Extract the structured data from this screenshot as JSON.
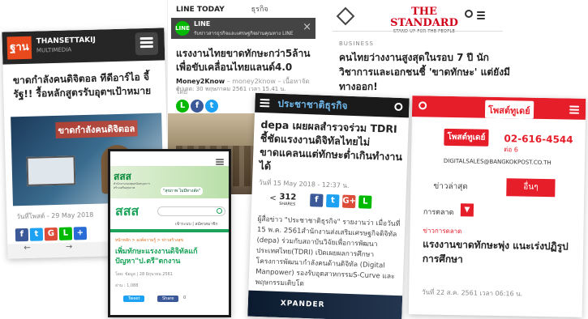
{
  "card1": {
    "logo_text": "ฐาน",
    "logo_sub": "THANSETTAKIJ",
    "logo_sub2": "MULTIMEDIA",
    "headline": "ขาดกำลังคนดิจิตอล ทีดีอาร์ไอ จี้รัฐ!! รื้อหลักสูตรรับอุตฯเป้าหมาย",
    "image_caption": "ขาดกำลังคนดิจิตอล",
    "date": "วันที่โพสต์ - 29 May 2018"
  },
  "card2": {
    "brand": "LINE TODAY",
    "tab2": "ธุรกิจ",
    "banner_title": "LINE",
    "banner_text": "รับข่าวสารธุรกิจและเศรษฐกิจผ่านคุณทาง LINE",
    "close": "×",
    "headline": "แรงงานไทยขาดทักษะกว่า5ล้าน เพื่อขับเคลื่อนไทยแลนด์4.0",
    "source": "Money2Know",
    "source_meta": "– money2know – เนื้อหาจัดโดย",
    "date": "อัปเดต: 30 พฤษภาคม 2561 เวลา 15.41 น."
  },
  "card3": {
    "logo": "THE STANDARD",
    "tagline": "STAND UP FOR THE PEOPLE",
    "section": "BUSINESS",
    "headline": "คนไทยว่างงานสูงสุดในรอบ 7 ปี นักวิชาการและเอกชนชี้ 'ขาดทักษะ' แต่ยังมีทางออก!"
  },
  "card4": {
    "logo": "ประชาชาติธุรกิจ",
    "headline": "depa เผยผลสำรวจร่วม TDRI ชี้ชัดแรงงานดิจิทัลไทยไม่ขาดแคลนแต่ทักษะต่ำเกินทำงานได้",
    "date": "วันที่ 15 May 2018 - 12:37 น.",
    "shares": "312",
    "shares_label": "SHARES",
    "body": "ผู้สื่อข่าว \"ประชาชาติธุรกิจ\" รายงานว่า เมื่อวันที่ 15 พ.ค. 2561สำนักงานส่งเสริมเศรษฐกิจดิจิทัล (depa) ร่วมกับสถาบันวิจัยเพื่อการพัฒนาประเทศไทย(TDRI) เปิดเผยผลการศึกษาโครงการพัฒนากำลังคนด้านดิจิทัล (Digital Manpower) รองรับอุตสาหกรรมS-Curve และ พฤษกรรมเติบโต",
    "ad_text": "XPANDER"
  },
  "card5": {
    "logo": "โพสต์ทูเดย์",
    "phone": "02-616-4544",
    "ext": "ต่อ 6",
    "email": "DIGITALSALES@BANGKOKPOST.CO.TH",
    "tab_latest": "ข่าวล่าสุด",
    "tab_others": "อื่นๆ",
    "category": "การตลาด",
    "subcategory": "ข่าวการตลาด",
    "headline": "แรงงานขาดทักษะพุ่ง แนะเร่งปฏิรูปการศึกษา",
    "date": "วันที่ 22 ส.ค. 2561 เวลา 06:16 น."
  },
  "card6": {
    "logo": "สสส",
    "logo_sub": "สำนักงานกองทุนสนับสนุนการสร้างเสริมสุขภาพ",
    "banner_text": "\"สุขภาพ ไม่มีทางลัด\"",
    "breadcrumb": "หน้าหลัก > องค์ความรู้ > ข่าวสร้างสุข",
    "headline": "เพิ่มทักษะแรงงานดิจิทัลแก้ปัญหา\"ป.ตรี\"ตกงาน",
    "meta": "โดย: ข้อมูล | 28 มิถุนายน 2561",
    "views": "อ่าน : 1,088",
    "share_tw": "Tweet",
    "share_fb": "Share",
    "share_count": "0",
    "login": "เข้าระบบ | สมัครสมาชิก"
  }
}
